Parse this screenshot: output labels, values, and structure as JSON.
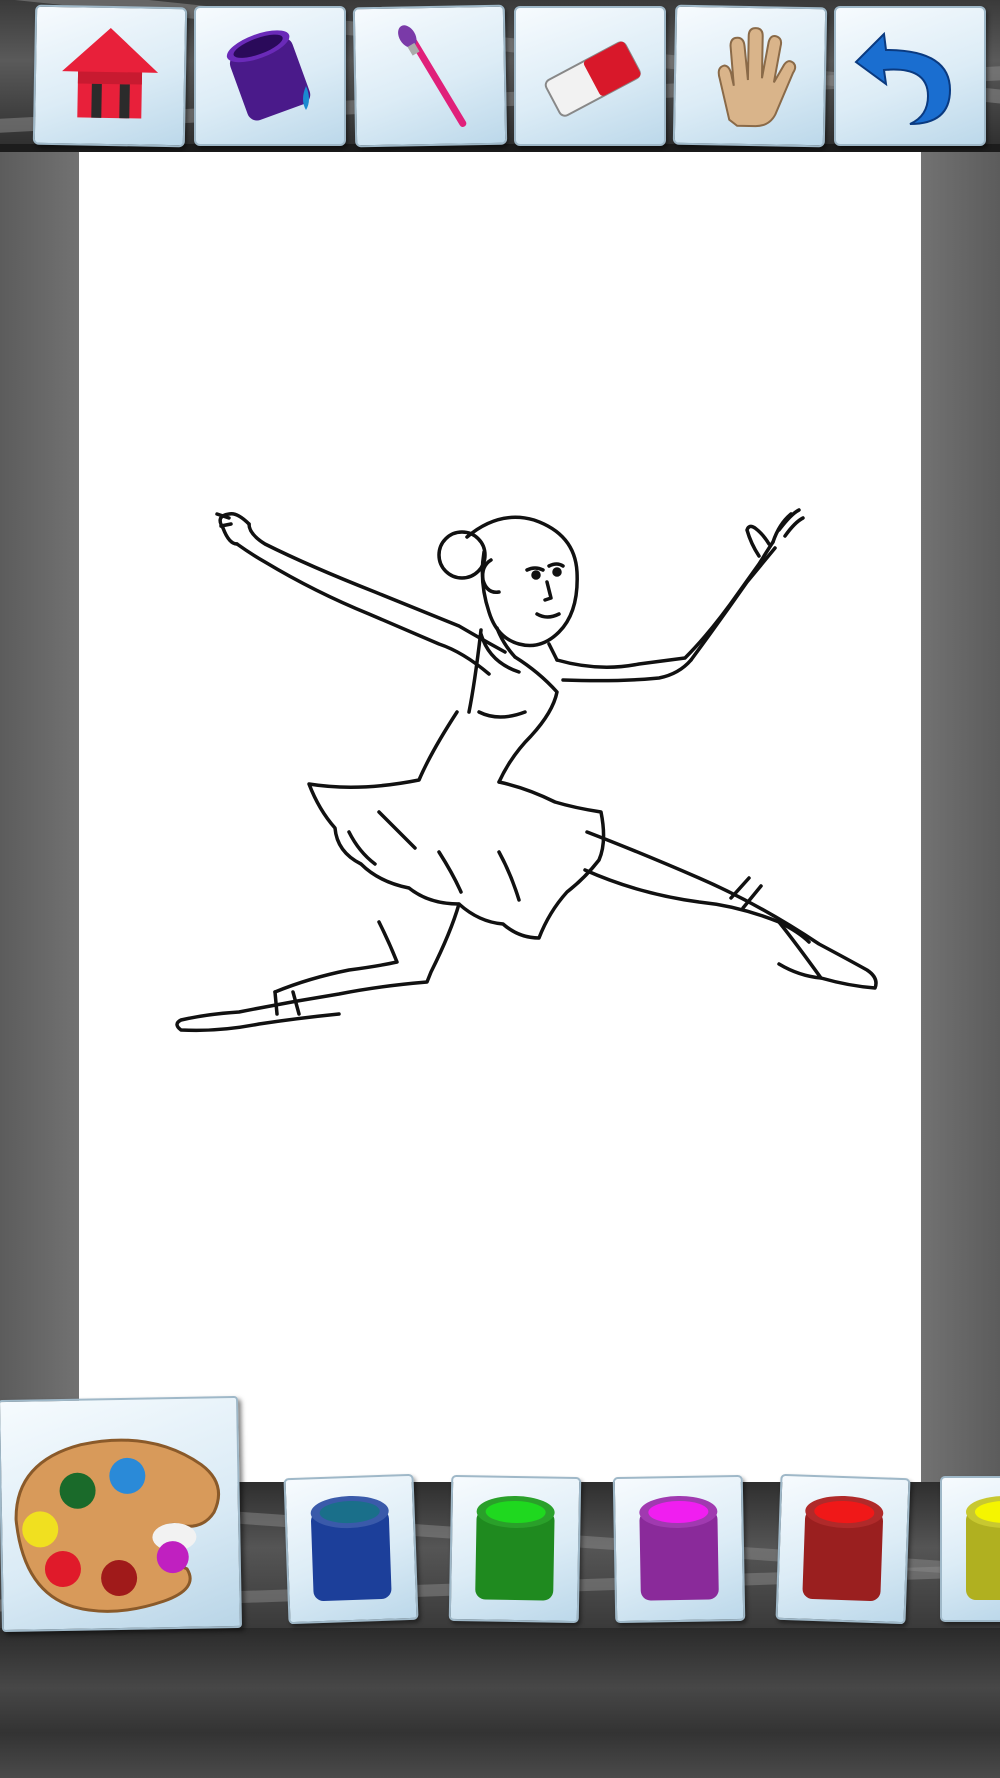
{
  "app": {
    "screen": "coloring-page"
  },
  "toolbar": {
    "tools": [
      {
        "name": "home",
        "icon": "home-icon"
      },
      {
        "name": "fill-bucket",
        "icon": "paint-bucket-icon"
      },
      {
        "name": "brush",
        "icon": "brush-icon"
      },
      {
        "name": "eraser",
        "icon": "eraser-icon"
      },
      {
        "name": "hand",
        "icon": "hand-icon"
      },
      {
        "name": "undo",
        "icon": "undo-icon"
      }
    ]
  },
  "canvas": {
    "drawing": "ballerina-line-art",
    "background": "#ffffff"
  },
  "palette": {
    "icon": "palette-icon",
    "colors": [
      {
        "name": "blue",
        "hex": "#1c3f9a",
        "top": "#1a6f8a"
      },
      {
        "name": "green",
        "hex": "#1f8a1f",
        "top": "#1fd81f"
      },
      {
        "name": "purple",
        "hex": "#8a2a9a",
        "top": "#f01ef0"
      },
      {
        "name": "red",
        "hex": "#9a1f1f",
        "top": "#f01818"
      },
      {
        "name": "yellow",
        "hex": "#b0b020",
        "top": "#f5f500"
      }
    ]
  },
  "colors": {
    "frame": "#6b6b6b",
    "card": "#dcecf6"
  }
}
